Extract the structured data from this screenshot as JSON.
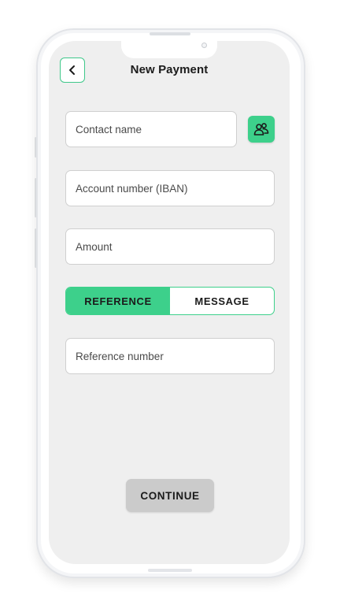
{
  "header": {
    "title": "New Payment",
    "back_icon": "chevron-left-icon"
  },
  "form": {
    "contact_name": {
      "value": "",
      "placeholder": "Contact name"
    },
    "contacts_icon": "users-icon",
    "account_number": {
      "value": "",
      "placeholder": "Account number (IBAN)"
    },
    "amount": {
      "value": "",
      "placeholder": "Amount"
    },
    "toggle": {
      "options": [
        "REFERENCE",
        "MESSAGE"
      ],
      "selected": "REFERENCE"
    },
    "reference_number": {
      "value": "",
      "placeholder": "Reference number"
    }
  },
  "footer": {
    "continue_label": "CONTINUE"
  },
  "colors": {
    "accent": "#3dd08b",
    "screen_bg": "#efefef",
    "button_disabled": "#cbcbcb"
  }
}
